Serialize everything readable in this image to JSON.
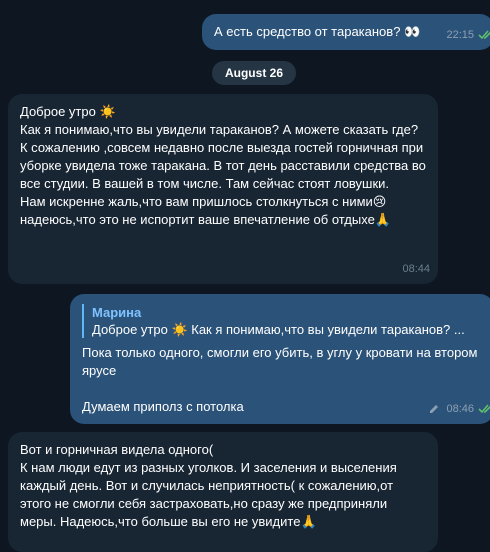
{
  "messages": [
    {
      "text": "А есть средство от тараканов? 👀",
      "time": "22:15"
    },
    {
      "date": "August 26"
    },
    {
      "text": "Доброе утро ☀️\nКак я понимаю,что вы увидели тараканов? А можете сказать где?\nК сожалению ,совсем недавно после выезда гостей горничная при уборке увидела тоже таракана. В тот день расставили средства во все студии. В вашей в том числе. Там сейчас стоят ловушки.\nНам искренне жаль,что вам пришлось столкнуться с ними😢\nнадеюсь,что это не испортит ваше впечатление об отдыхе🙏",
      "time": "08:44"
    },
    {
      "reply_author": "Марина",
      "reply_text": "Доброе утро ☀️  Как я понимаю,что вы увидели тараканов? ...",
      "text": "Пока только одного, смогли его убить, в углу у кровати на втором ярусе\n\nДумаем приполз с потолка",
      "time": "08:46"
    },
    {
      "text": "Вот и горничная видела одного(\nК нам люди едут из разных уголков. И заселения и выселения каждый день. Вот и случилась неприятность( к сожалению,от этого не смогли себя застраховать,но сразу же предприняли меры. Надеюсь,что больше вы его не увидите🙏"
    }
  ],
  "colors": {
    "background": "#0e1621",
    "outgoing_bubble": "#2b5278",
    "incoming_bubble": "#182533",
    "read_check": "#5fbf6f",
    "reply_author": "#7fc2ff"
  }
}
